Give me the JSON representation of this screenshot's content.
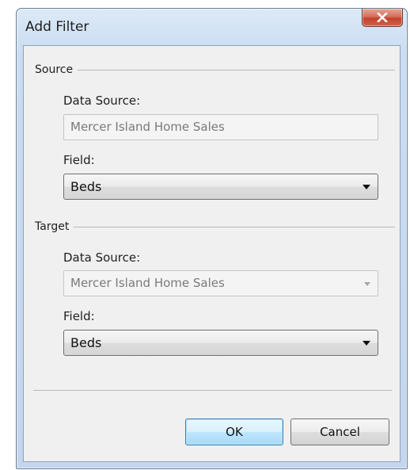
{
  "dialog": {
    "title": "Add Filter",
    "close_icon": "close-x-icon"
  },
  "source": {
    "group_label": "Source",
    "data_source_label": "Data Source:",
    "data_source_value": "Mercer Island Home Sales",
    "field_label": "Field:",
    "field_value": "Beds"
  },
  "target": {
    "group_label": "Target",
    "data_source_label": "Data Source:",
    "data_source_value": "Mercer Island Home Sales",
    "field_label": "Field:",
    "field_value": "Beds"
  },
  "buttons": {
    "ok_label": "OK",
    "cancel_label": "Cancel"
  },
  "colors": {
    "close_button": "#c2432c",
    "default_button_border": "#3c7fb1",
    "window_frame": "#c9dcf1"
  }
}
